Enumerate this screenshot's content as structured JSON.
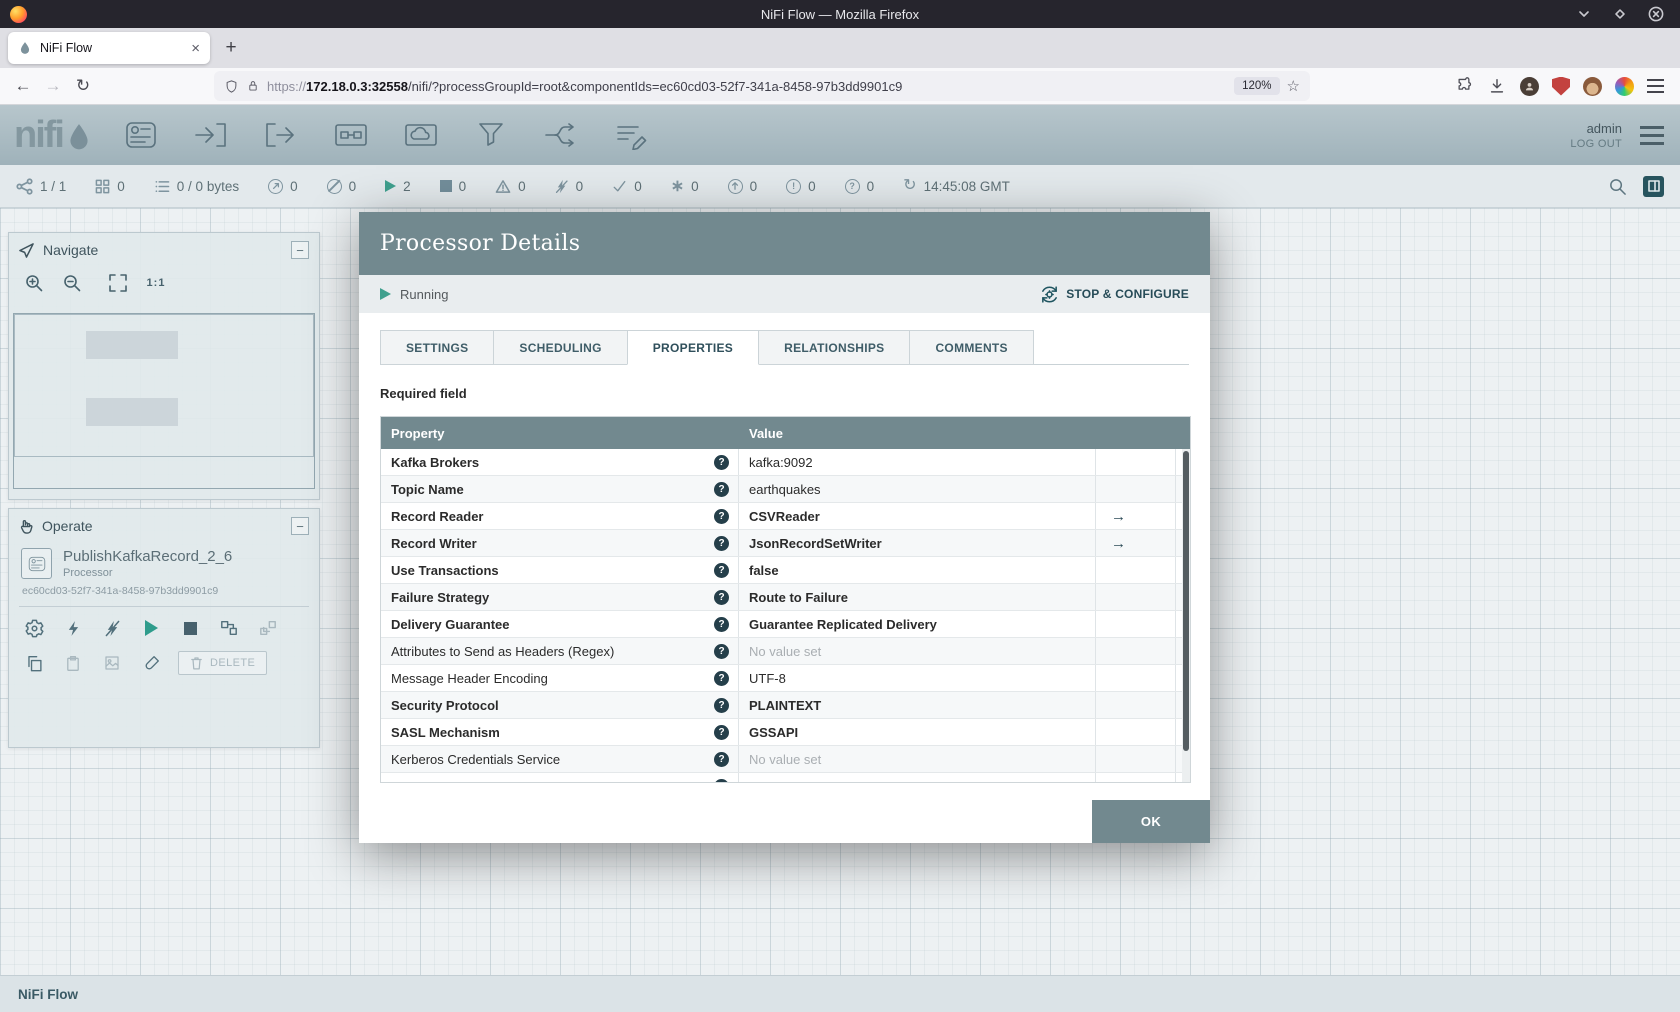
{
  "window": {
    "title": "NiFi Flow — Mozilla Firefox"
  },
  "browser": {
    "tab_title": "NiFi Flow",
    "url_scheme": "https://",
    "url_host": "172.18.0.3:32558",
    "url_path": "/nifi/?processGroupId=root&componentIds=ec60cd03-52f7-341a-8458-97b3dd9901c9",
    "zoom": "120%"
  },
  "icons": {
    "close_tab": "×",
    "new_tab": "+",
    "back": "←",
    "forward": "→",
    "reload": "↻",
    "star": "☆",
    "collapse": "−",
    "goto": "→",
    "help": "?",
    "asterisk": "∗",
    "refresh": "↻",
    "actual_size": "1:1"
  },
  "nifi": {
    "logo": "nifi",
    "user": "admin",
    "logout": "LOG OUT",
    "status": {
      "cluster": "1 / 1",
      "threads": "0",
      "queued": "0 / 0 bytes",
      "transmitting": "0",
      "not_transmitting": "0",
      "running": "2",
      "stopped": "0",
      "invalid": "0",
      "disabled": "0",
      "up_to_date": "0",
      "locally_modified": "0",
      "stale": "0",
      "modified_stale": "0",
      "sync_failure": "0",
      "time": "14:45:08 GMT"
    },
    "navigate": {
      "title": "Navigate"
    },
    "operate": {
      "title": "Operate",
      "name": "PublishKafkaRecord_2_6",
      "type": "Processor",
      "id": "ec60cd03-52f7-341a-8458-97b3dd9901c9",
      "delete": "DELETE"
    },
    "breadcrumb": "NiFi Flow"
  },
  "dialog": {
    "title": "Processor Details",
    "state": "Running",
    "stop_configure": "STOP & CONFIGURE",
    "tabs": {
      "settings": "SETTINGS",
      "scheduling": "SCHEDULING",
      "properties": "PROPERTIES",
      "relationships": "RELATIONSHIPS",
      "comments": "COMMENTS"
    },
    "required_field": "Required field",
    "table": {
      "property_header": "Property",
      "value_header": "Value",
      "rows": [
        {
          "property": "Kafka Brokers",
          "value": "kafka:9092",
          "required": true,
          "value_style": "normal",
          "goto": false
        },
        {
          "property": "Topic Name",
          "value": "earthquakes",
          "required": true,
          "value_style": "normal",
          "goto": false
        },
        {
          "property": "Record Reader",
          "value": "CSVReader",
          "required": true,
          "value_style": "bold",
          "goto": true
        },
        {
          "property": "Record Writer",
          "value": "JsonRecordSetWriter",
          "required": true,
          "value_style": "bold",
          "goto": true
        },
        {
          "property": "Use Transactions",
          "value": "false",
          "required": true,
          "value_style": "bold",
          "goto": false
        },
        {
          "property": "Failure Strategy",
          "value": "Route to Failure",
          "required": true,
          "value_style": "bold",
          "goto": false
        },
        {
          "property": "Delivery Guarantee",
          "value": "Guarantee Replicated Delivery",
          "required": true,
          "value_style": "bold",
          "goto": false
        },
        {
          "property": "Attributes to Send as Headers (Regex)",
          "value": "No value set",
          "required": false,
          "value_style": "unset",
          "goto": false
        },
        {
          "property": "Message Header Encoding",
          "value": "UTF-8",
          "required": false,
          "value_style": "normal",
          "goto": false
        },
        {
          "property": "Security Protocol",
          "value": "PLAINTEXT",
          "required": true,
          "value_style": "bold",
          "goto": false
        },
        {
          "property": "SASL Mechanism",
          "value": "GSSAPI",
          "required": true,
          "value_style": "bold",
          "goto": false
        },
        {
          "property": "Kerberos Credentials Service",
          "value": "No value set",
          "required": false,
          "value_style": "unset",
          "goto": false
        }
      ]
    },
    "ok": "OK"
  }
}
